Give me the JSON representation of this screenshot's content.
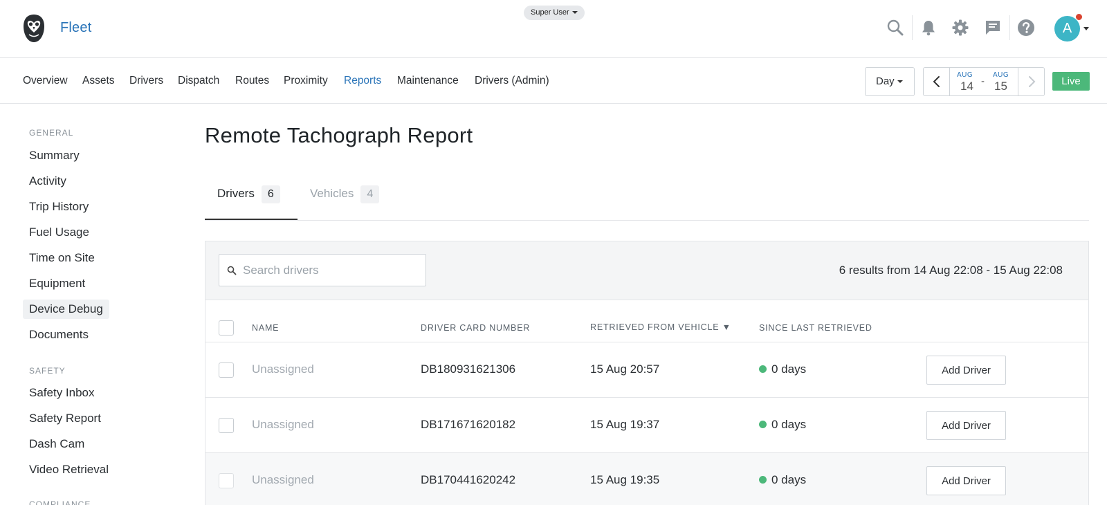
{
  "header": {
    "brand": "Fleet",
    "role_label": "Super User",
    "avatar_initial": "A",
    "icons": [
      "search-icon",
      "bell-icon",
      "gear-icon",
      "chat-icon",
      "help-icon"
    ]
  },
  "nav": {
    "items": [
      "Overview",
      "Assets",
      "Drivers",
      "Dispatch",
      "Routes",
      "Proximity",
      "Reports",
      "Maintenance",
      "Drivers (Admin)"
    ],
    "active": "Reports",
    "period_label": "Day",
    "date_from": {
      "month": "AUG",
      "day": "14"
    },
    "date_to": {
      "month": "AUG",
      "day": "15"
    },
    "date_separator": "-",
    "live_label": "Live"
  },
  "sidebar": {
    "general_heading": "GENERAL",
    "general_items": [
      "Summary",
      "Activity",
      "Trip History",
      "Fuel Usage",
      "Time on Site",
      "Equipment",
      "Device Debug",
      "Documents"
    ],
    "safety_heading": "SAFETY",
    "safety_items": [
      "Safety Inbox",
      "Safety Report",
      "Dash Cam",
      "Video Retrieval"
    ],
    "compliance_heading": "COMPLIANCE"
  },
  "page": {
    "title": "Remote Tachograph Report",
    "tabs": [
      {
        "label": "Drivers",
        "count": "6"
      },
      {
        "label": "Vehicles",
        "count": "4"
      }
    ],
    "search_placeholder": "Search drivers",
    "results_text": "6 results from 14 Aug 22:08 - 15 Aug 22:08",
    "columns": [
      "NAME",
      "DRIVER CARD NUMBER",
      "RETRIEVED FROM VEHICLE ▼",
      "SINCE LAST RETRIEVED"
    ],
    "rows": [
      {
        "name": "Unassigned",
        "card": "DB180931621306",
        "retrieved": "15 Aug 20:57",
        "since": "0 days",
        "action": "Add Driver"
      },
      {
        "name": "Unassigned",
        "card": "DB171671620182",
        "retrieved": "15 Aug 19:37",
        "since": "0 days",
        "action": "Add Driver"
      },
      {
        "name": "Unassigned",
        "card": "DB170441620242",
        "retrieved": "15 Aug 19:35",
        "since": "0 days",
        "action": "Add Driver"
      }
    ]
  },
  "colors": {
    "accent": "#2a74b8",
    "live": "#4cb87a",
    "status_ok": "#4cb87a",
    "avatar": "#3db5c6",
    "notification": "#d9432f"
  }
}
